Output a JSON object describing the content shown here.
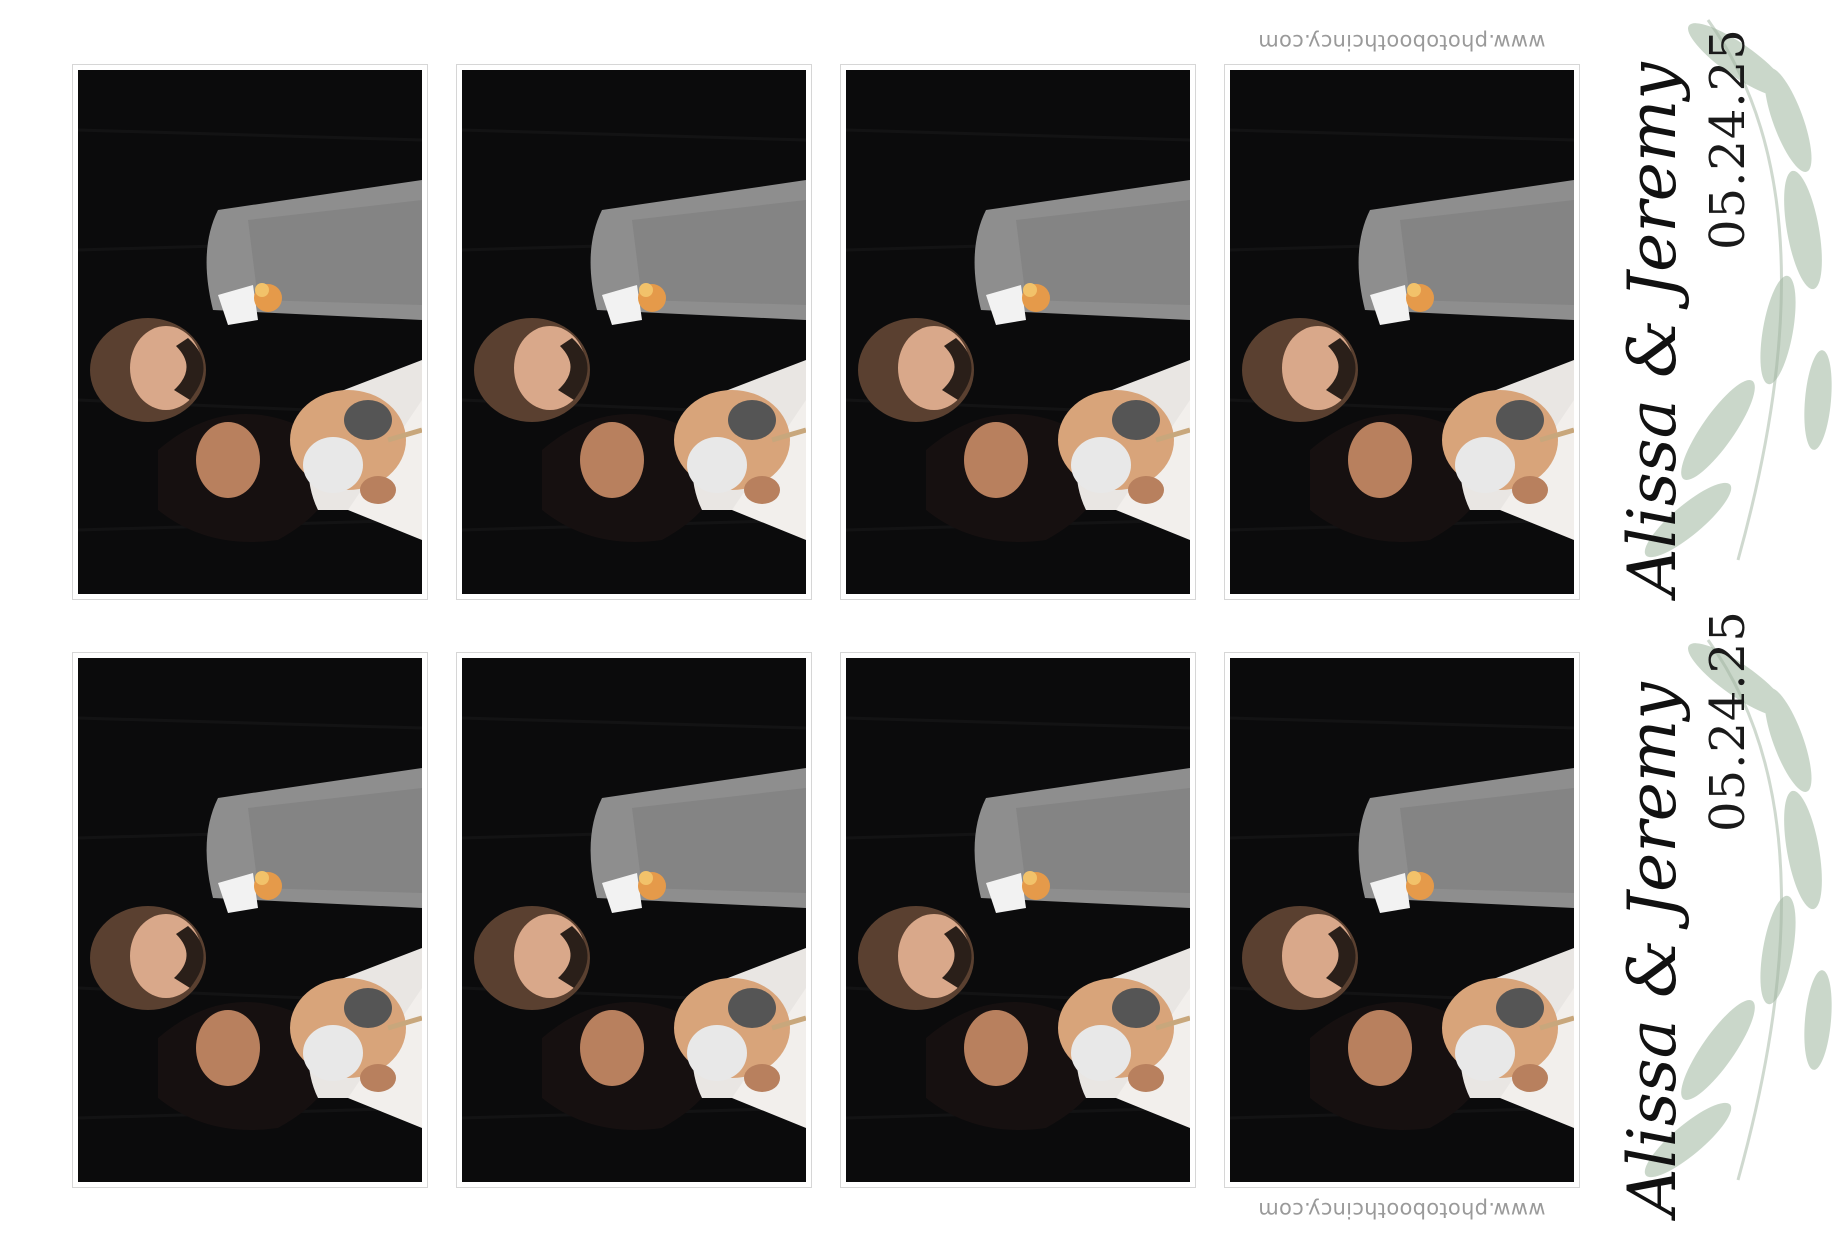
{
  "couple_names": "Alissa & Jeremy",
  "event_date": "05.24.25",
  "watermark": "www.photoboothcincy.com",
  "colors": {
    "backdrop": "#0b0b0c",
    "suit": "#8e8e8e",
    "dress": "#e9e6e3",
    "leaf": "#9fb8a0",
    "frame_border": "#d6d6d6"
  },
  "strips": [
    {
      "id": "top",
      "photos": 4
    },
    {
      "id": "bottom",
      "photos": 4
    }
  ]
}
